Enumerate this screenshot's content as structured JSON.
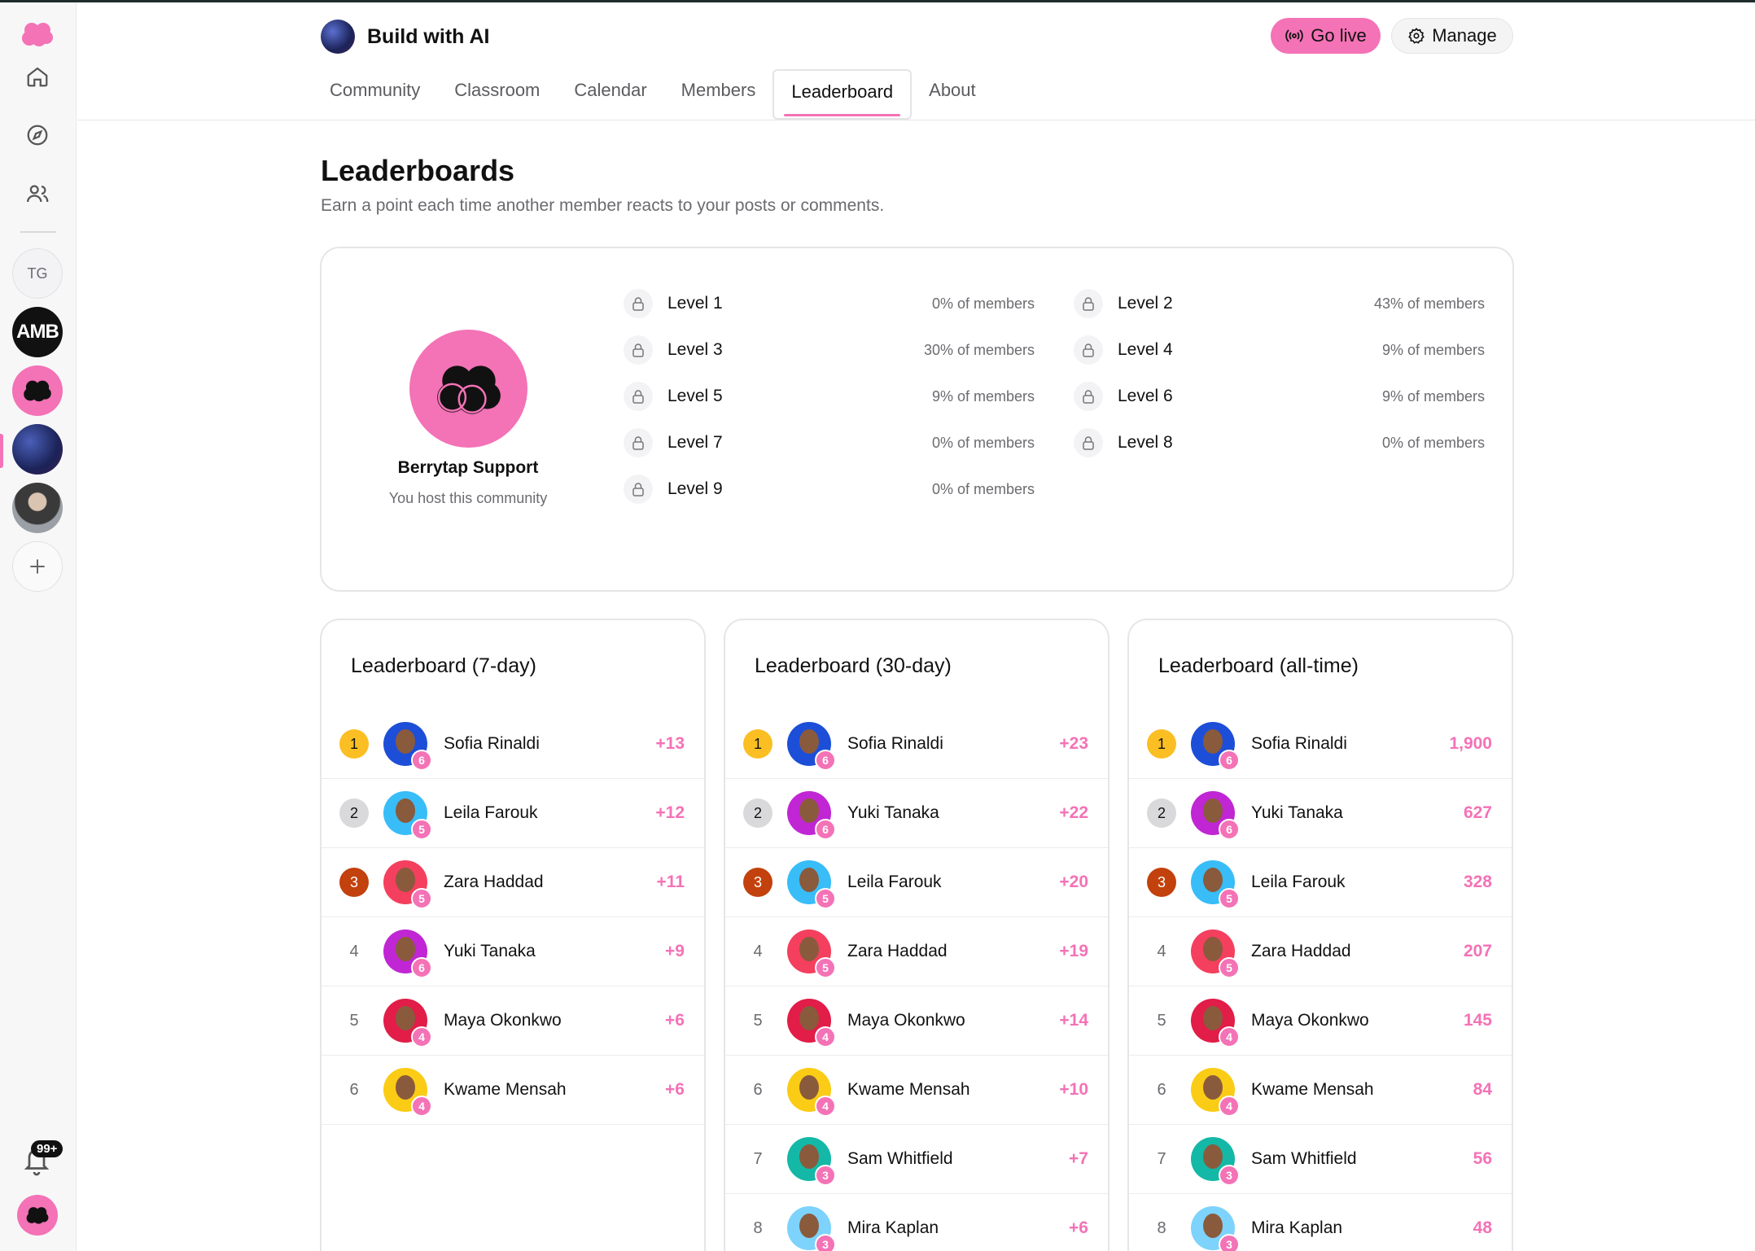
{
  "app": {
    "group_title": "Build with AI",
    "go_live_label": "Go live",
    "manage_label": "Manage",
    "notification_count": "99+"
  },
  "sidebar": {
    "tg_label": "TG",
    "amb_label": "AMB"
  },
  "tabs": [
    {
      "label": "Community",
      "active": false
    },
    {
      "label": "Classroom",
      "active": false
    },
    {
      "label": "Calendar",
      "active": false
    },
    {
      "label": "Members",
      "active": false
    },
    {
      "label": "Leaderboard",
      "active": true
    },
    {
      "label": "About",
      "active": false
    }
  ],
  "page": {
    "title": "Leaderboards",
    "subtitle": "Earn a point each time another member reacts to your posts or comments."
  },
  "host": {
    "name": "Berrytap Support",
    "note": "You host this community"
  },
  "levels": [
    {
      "label": "Level 1",
      "pct": "0% of members"
    },
    {
      "label": "Level 2",
      "pct": "43% of members"
    },
    {
      "label": "Level 3",
      "pct": "30% of members"
    },
    {
      "label": "Level 4",
      "pct": "9% of members"
    },
    {
      "label": "Level 5",
      "pct": "9% of members"
    },
    {
      "label": "Level 6",
      "pct": "9% of members"
    },
    {
      "label": "Level 7",
      "pct": "0% of members"
    },
    {
      "label": "Level 8",
      "pct": "0% of members"
    },
    {
      "label": "Level 9",
      "pct": "0% of members"
    }
  ],
  "leaderboards": [
    {
      "title": "Leaderboard (7-day)",
      "rows": [
        {
          "rank": "1",
          "name": "Sofia Rinaldi",
          "level": "6",
          "score": "+13"
        },
        {
          "rank": "2",
          "name": "Leila Farouk",
          "level": "5",
          "score": "+12"
        },
        {
          "rank": "3",
          "name": "Zara Haddad",
          "level": "5",
          "score": "+11"
        },
        {
          "rank": "4",
          "name": "Yuki Tanaka",
          "level": "6",
          "score": "+9"
        },
        {
          "rank": "5",
          "name": "Maya Okonkwo",
          "level": "4",
          "score": "+6"
        },
        {
          "rank": "6",
          "name": "Kwame Mensah",
          "level": "4",
          "score": "+6"
        }
      ]
    },
    {
      "title": "Leaderboard (30-day)",
      "rows": [
        {
          "rank": "1",
          "name": "Sofia Rinaldi",
          "level": "6",
          "score": "+23"
        },
        {
          "rank": "2",
          "name": "Yuki Tanaka",
          "level": "6",
          "score": "+22"
        },
        {
          "rank": "3",
          "name": "Leila Farouk",
          "level": "5",
          "score": "+20"
        },
        {
          "rank": "4",
          "name": "Zara Haddad",
          "level": "5",
          "score": "+19"
        },
        {
          "rank": "5",
          "name": "Maya Okonkwo",
          "level": "4",
          "score": "+14"
        },
        {
          "rank": "6",
          "name": "Kwame Mensah",
          "level": "4",
          "score": "+10"
        },
        {
          "rank": "7",
          "name": "Sam Whitfield",
          "level": "3",
          "score": "+7"
        },
        {
          "rank": "8",
          "name": "Mira Kaplan",
          "level": "3",
          "score": "+6"
        }
      ]
    },
    {
      "title": "Leaderboard (all-time)",
      "rows": [
        {
          "rank": "1",
          "name": "Sofia Rinaldi",
          "level": "6",
          "score": "1,900"
        },
        {
          "rank": "2",
          "name": "Yuki Tanaka",
          "level": "6",
          "score": "627"
        },
        {
          "rank": "3",
          "name": "Leila Farouk",
          "level": "5",
          "score": "328"
        },
        {
          "rank": "4",
          "name": "Zara Haddad",
          "level": "5",
          "score": "207"
        },
        {
          "rank": "5",
          "name": "Maya Okonkwo",
          "level": "4",
          "score": "145"
        },
        {
          "rank": "6",
          "name": "Kwame Mensah",
          "level": "4",
          "score": "84"
        },
        {
          "rank": "7",
          "name": "Sam Whitfield",
          "level": "3",
          "score": "56"
        },
        {
          "rank": "8",
          "name": "Mira Kaplan",
          "level": "3",
          "score": "48"
        }
      ]
    }
  ],
  "colors": {
    "accent": "#f472b6",
    "gold": "#fbbf24",
    "silver": "#d9d9dc",
    "bronze": "#c2410c"
  },
  "avatar_colors": {
    "Sofia Rinaldi": "#1d4ed8",
    "Leila Farouk": "#38bdf8",
    "Zara Haddad": "#f43f5e",
    "Yuki Tanaka": "#c026d3",
    "Maya Okonkwo": "#e11d48",
    "Kwame Mensah": "#facc15",
    "Sam Whitfield": "#14b8a6",
    "Mira Kaplan": "#7dd3fc"
  }
}
